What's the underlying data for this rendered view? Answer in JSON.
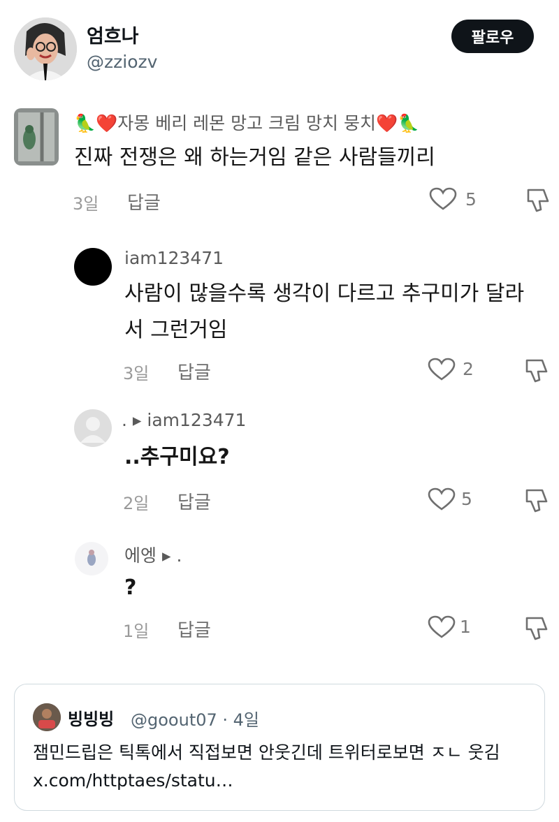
{
  "tweet": {
    "author_name": "엄흐나",
    "author_handle": "@zziozv",
    "follow_label": "팔로우"
  },
  "comments": [
    {
      "user": "🦜❤️자몽 베리 레몬 망고 크림 망치 뭉치❤️🦜",
      "text": "진짜 전쟁은 왜 하는거임 같은 사람들끼리",
      "time": "3일",
      "reply": "답글",
      "likes": "5"
    },
    {
      "user": "iam123471",
      "text_lines": [
        "사람이 많을수록 생각이 다르고 추구미가 달라",
        "서 그런거임"
      ],
      "time": "3일",
      "reply": "답글",
      "likes": "2"
    },
    {
      "user": ". ▸ iam123471",
      "text": "..추구미요?",
      "time": "2일",
      "reply": "답글",
      "likes": "5"
    },
    {
      "user": "에엥 ▸ .",
      "text": "?",
      "time": "1일",
      "reply": "답글",
      "likes": "1"
    }
  ],
  "quote": {
    "author_name": "빙빙빙",
    "author_handle": "@goout07 · 4일",
    "text": "잼민드립은 틱톡에서 직접보면 안웃긴데 트위터로보면 ㅈㄴ 웃김 x.com/httptaes/statu…"
  }
}
